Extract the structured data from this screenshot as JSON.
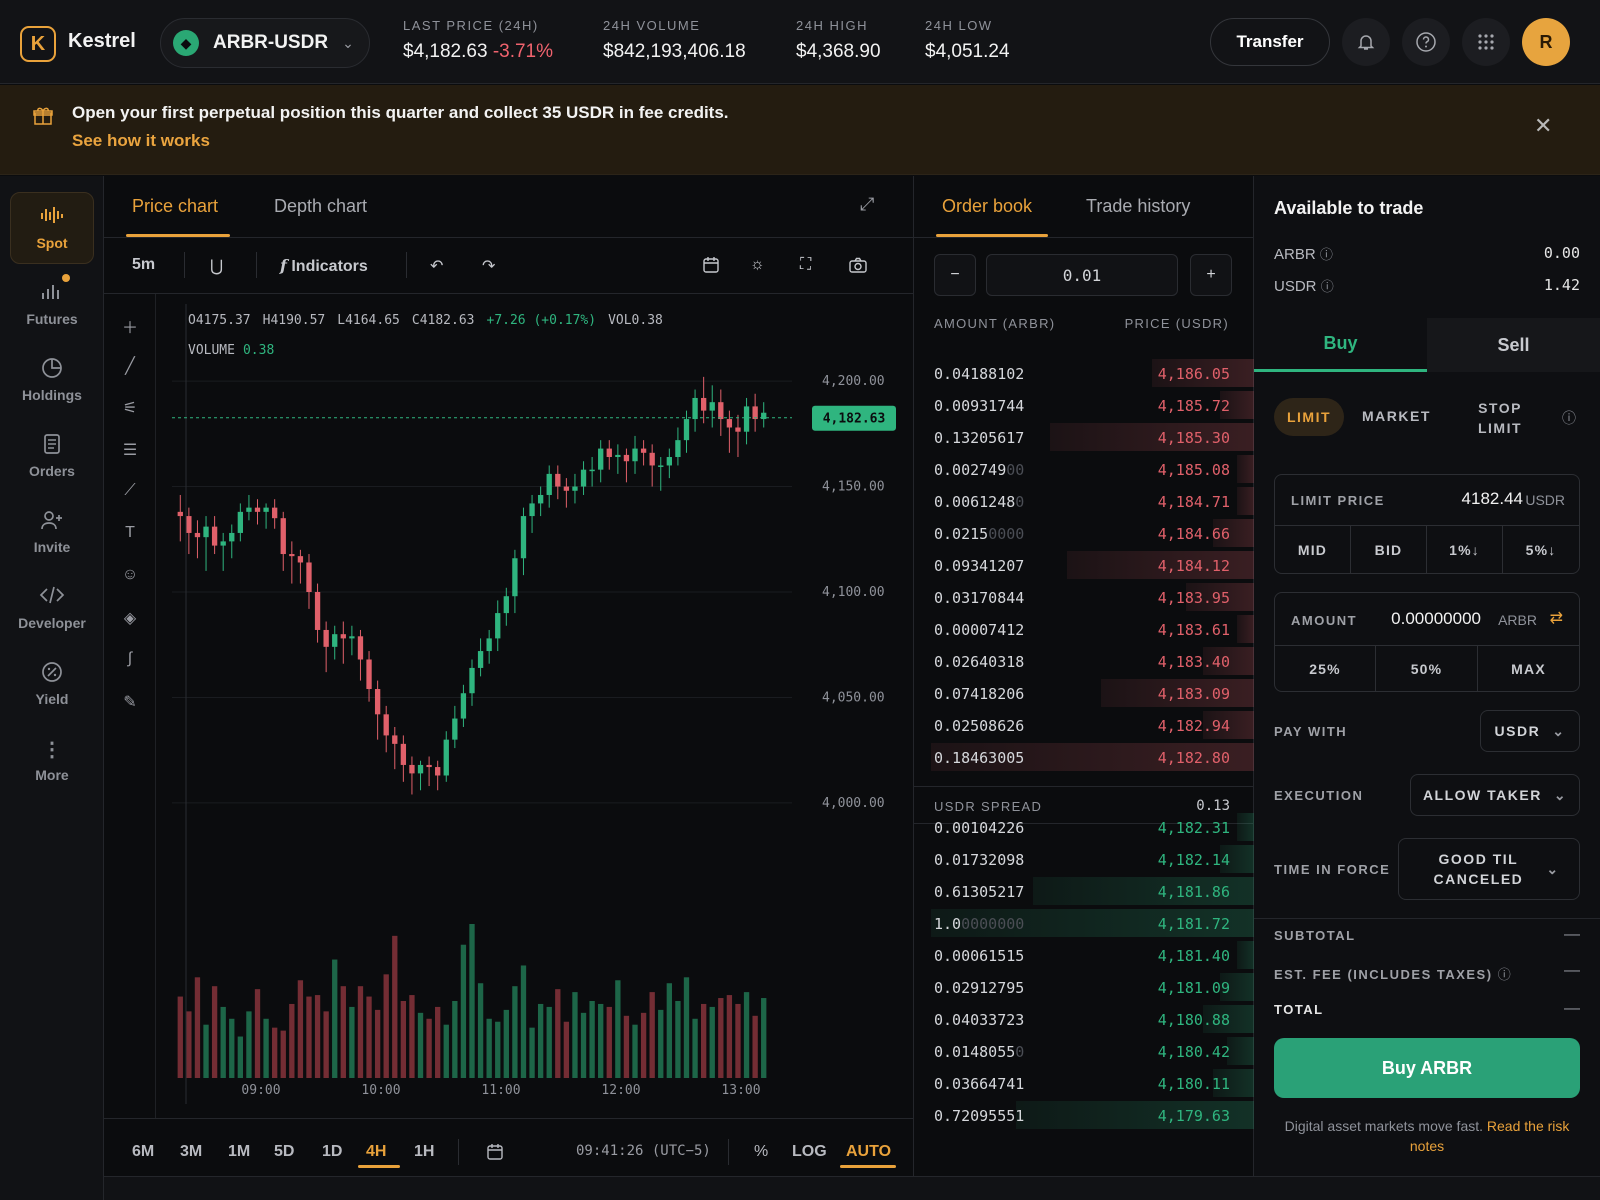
{
  "app": {
    "name": "Kestrel",
    "logo_letter": "K"
  },
  "pair": {
    "name": "ARBR-USDR",
    "icon": "diamond-icon"
  },
  "stats": [
    {
      "label": "LAST PRICE (24H)",
      "value": "$4,182.63",
      "change": "-3.71%"
    },
    {
      "label": "24H VOLUME",
      "value": "$842,193,406.18"
    },
    {
      "label": "24H HIGH",
      "value": "$4,368.90"
    },
    {
      "label": "24H LOW",
      "value": "$4,051.24"
    }
  ],
  "header": {
    "transfer_label": "Transfer",
    "avatar_initial": "R"
  },
  "promo": {
    "text": "Open your first perpetual position this quarter and collect 35 USDR in fee credits.",
    "link": "See how it works"
  },
  "sidebar": {
    "items": [
      {
        "label": "Spot",
        "icon": "spot-icon"
      },
      {
        "label": "Futures",
        "icon": "futures-icon"
      },
      {
        "label": "Holdings",
        "icon": "pie-icon"
      },
      {
        "label": "Orders",
        "icon": "document-icon"
      },
      {
        "label": "Invite",
        "icon": "add-user-icon"
      },
      {
        "label": "Developer",
        "icon": "code-icon"
      },
      {
        "label": "Yield",
        "icon": "percent-icon"
      },
      {
        "label": "More",
        "icon": "more-icon"
      }
    ]
  },
  "chart_panel": {
    "tabs": [
      "Price chart",
      "Depth chart"
    ],
    "interval": "5m",
    "indicators_label": "Indicators",
    "ohlc": {
      "o": "O4175.37",
      "h": "H4190.57",
      "l": "L4164.65",
      "c": "C4182.63",
      "chg": "+7.26 (+0.17%)",
      "vol": "VOL0.38"
    },
    "volume_label": "VOLUME",
    "volume_value": "0.38",
    "ranges": [
      "6M",
      "3M",
      "1M",
      "5D",
      "1D",
      "4H",
      "1H"
    ],
    "active_range": "4H",
    "clock": "09:41:26 (UTC−5)",
    "percent_label": "%",
    "log_label": "LOG",
    "auto_label": "AUTO"
  },
  "chart_data": {
    "type": "candlestick",
    "y_ticks": [
      "4,200.00",
      "4,150.00",
      "4,100.00",
      "4,050.00",
      "4,000.00"
    ],
    "y_tick_values": [
      4200,
      4150,
      4100,
      4050,
      4000
    ],
    "ylim": [
      3990,
      4210
    ],
    "x_ticks": [
      "09:00",
      "10:00",
      "11:00",
      "12:00",
      "13:00"
    ],
    "last_price_label": "4,182.63",
    "last_price": 4182.63,
    "colors": {
      "up": "#2fb57f",
      "down": "#e0606a"
    },
    "candles": [
      [
        4138,
        4136,
        4146,
        4124,
        3
      ],
      [
        4136,
        4128,
        4140,
        4118,
        5
      ],
      [
        4128,
        4126,
        4134,
        4116,
        2
      ],
      [
        4126,
        4131,
        4136,
        4110,
        3
      ],
      [
        4131,
        4122,
        4136,
        4118,
        6
      ],
      [
        4122,
        4124,
        4128,
        4110,
        7
      ],
      [
        4124,
        4128,
        4132,
        4116,
        4
      ],
      [
        4128,
        4138,
        4142,
        4124,
        5
      ],
      [
        4138,
        4140,
        4146,
        4134,
        2
      ],
      [
        4140,
        4138,
        4144,
        4132,
        3
      ],
      [
        4138,
        4140,
        4142,
        4130,
        2
      ],
      [
        4140,
        4135,
        4144,
        4130,
        5
      ],
      [
        4135,
        4118,
        4138,
        4110,
        4
      ],
      [
        4118,
        4117,
        4124,
        4104,
        2
      ],
      [
        4117,
        4114,
        4120,
        4104,
        5
      ],
      [
        4114,
        4100,
        4118,
        4092,
        3
      ],
      [
        4100,
        4082,
        4104,
        4076,
        6
      ],
      [
        4082,
        4074,
        4086,
        4062,
        4
      ],
      [
        4074,
        4080,
        4084,
        4068,
        3
      ],
      [
        4080,
        4078,
        4086,
        4066,
        4
      ],
      [
        4078,
        4079,
        4084,
        4070,
        5
      ],
      [
        4079,
        4068,
        4082,
        4058,
        7
      ],
      [
        4068,
        4054,
        4072,
        4048,
        4
      ],
      [
        4054,
        4042,
        4058,
        4030,
        5
      ],
      [
        4042,
        4032,
        4046,
        4024,
        6
      ],
      [
        4032,
        4028,
        4036,
        4016,
        3
      ],
      [
        4028,
        4018,
        4032,
        4010,
        4
      ],
      [
        4018,
        4014,
        4022,
        4004,
        3
      ],
      [
        4014,
        4018,
        4020,
        4006,
        4
      ],
      [
        4018,
        4017,
        4022,
        4008,
        5
      ],
      [
        4017,
        4013,
        4020,
        4006,
        3
      ],
      [
        4013,
        4030,
        4034,
        4010,
        6
      ],
      [
        4030,
        4040,
        4046,
        4026,
        4
      ],
      [
        4040,
        4052,
        4056,
        4036,
        5
      ],
      [
        4052,
        4064,
        4068,
        4046,
        5
      ],
      [
        4064,
        4072,
        4078,
        4060,
        6
      ],
      [
        4072,
        4078,
        4082,
        4066,
        4
      ],
      [
        4078,
        4090,
        4096,
        4072,
        6
      ],
      [
        4090,
        4098,
        4102,
        4084,
        3
      ],
      [
        4098,
        4116,
        4120,
        4090,
        5
      ],
      [
        4116,
        4136,
        4140,
        4108,
        7
      ],
      [
        4136,
        4142,
        4146,
        4128,
        4
      ],
      [
        4142,
        4146,
        4150,
        4136,
        3
      ],
      [
        4146,
        4156,
        4160,
        4140,
        6
      ],
      [
        4156,
        4150,
        4160,
        4144,
        4
      ],
      [
        4150,
        4148,
        4154,
        4140,
        3
      ],
      [
        4148,
        4150,
        4156,
        4142,
        5
      ],
      [
        4150,
        4158,
        4162,
        4146,
        4
      ],
      [
        4158,
        4158,
        4164,
        4150,
        3
      ],
      [
        4158,
        4168,
        4172,
        4152,
        5
      ],
      [
        4168,
        4164,
        4172,
        4158,
        4
      ],
      [
        4164,
        4165,
        4170,
        4156,
        3
      ],
      [
        4165,
        4162,
        4168,
        4152,
        5
      ],
      [
        4162,
        4168,
        4174,
        4156,
        4
      ],
      [
        4168,
        4166,
        4172,
        4160,
        3
      ],
      [
        4166,
        4160,
        4170,
        4150,
        6
      ],
      [
        4160,
        4160,
        4164,
        4148,
        5
      ],
      [
        4160,
        4164,
        4168,
        4154,
        4
      ],
      [
        4164,
        4172,
        4178,
        4160,
        6
      ],
      [
        4172,
        4182,
        4186,
        4166,
        7
      ],
      [
        4182,
        4192,
        4196,
        4176,
        5
      ],
      [
        4192,
        4186,
        4202,
        4180,
        4
      ],
      [
        4186,
        4190,
        4198,
        4178,
        5
      ],
      [
        4190,
        4182,
        4196,
        4174,
        3
      ],
      [
        4182,
        4178,
        4186,
        4166,
        4
      ],
      [
        4178,
        4176,
        4184,
        4164,
        3
      ],
      [
        4176,
        4188,
        4192,
        4170,
        5
      ],
      [
        4188,
        4182,
        4194,
        4176,
        2
      ],
      [
        4182,
        4185,
        4190,
        4178,
        3
      ]
    ],
    "volumes": [
      55,
      45,
      68,
      36,
      62,
      48,
      40,
      28,
      45,
      60,
      40,
      34,
      32,
      50,
      66,
      55,
      56,
      45,
      80,
      62,
      48,
      62,
      55,
      46,
      70,
      96,
      52,
      56,
      44,
      40,
      48,
      36,
      52,
      90,
      104,
      64,
      40,
      38,
      46,
      62,
      76,
      34,
      50,
      48,
      60,
      38,
      58,
      44,
      52,
      50,
      48,
      66,
      42,
      36,
      44,
      58,
      46,
      64,
      52,
      68,
      40,
      50,
      48,
      54,
      56,
      50,
      58,
      42,
      54
    ]
  },
  "order_book": {
    "tabs": [
      "Order book",
      "Trade history"
    ],
    "step": "0.01",
    "minus": "−",
    "plus": "+",
    "headers": {
      "amount": "AMOUNT (ARBR)",
      "price": "PRICE (USDR)"
    },
    "asks": [
      {
        "amt": "0.04188102",
        "dim": "",
        "price": "4,186.05",
        "depth": 0.3
      },
      {
        "amt": "0.00931744",
        "dim": "",
        "price": "4,185.72",
        "depth": 0.1
      },
      {
        "amt": "0.13205617",
        "dim": "",
        "price": "4,185.30",
        "depth": 0.6
      },
      {
        "amt": "0.002749",
        "dim": "00",
        "price": "4,185.08",
        "depth": 0.05
      },
      {
        "amt": "0.0061248",
        "dim": "0",
        "price": "4,184.71",
        "depth": 0.05
      },
      {
        "amt": "0.0215",
        "dim": "0000",
        "price": "4,184.66",
        "depth": 0.12
      },
      {
        "amt": "0.09341207",
        "dim": "",
        "price": "4,184.12",
        "depth": 0.55
      },
      {
        "amt": "0.03170844",
        "dim": "",
        "price": "4,183.95",
        "depth": 0.2
      },
      {
        "amt": "0.00007412",
        "dim": "",
        "price": "4,183.61",
        "depth": 0.05
      },
      {
        "amt": "0.02640318",
        "dim": "",
        "price": "4,183.40",
        "depth": 0.15
      },
      {
        "amt": "0.07418206",
        "dim": "",
        "price": "4,183.09",
        "depth": 0.45
      },
      {
        "amt": "0.02508626",
        "dim": "",
        "price": "4,182.94",
        "depth": 0.15
      },
      {
        "amt": "0.18463005",
        "dim": "",
        "price": "4,182.80",
        "depth": 0.95
      }
    ],
    "spread_label": "USDR SPREAD",
    "spread_value": "0.13",
    "bids": [
      {
        "amt": "0.00104226",
        "dim": "",
        "price": "4,182.31",
        "depth": 0.05
      },
      {
        "amt": "0.01732098",
        "dim": "",
        "price": "4,182.14",
        "depth": 0.1
      },
      {
        "amt": "0.61305217",
        "dim": "",
        "price": "4,181.86",
        "depth": 0.65
      },
      {
        "amt": "1.0",
        "dim": "0000000",
        "price": "4,181.72",
        "depth": 0.95
      },
      {
        "amt": "0.00061515",
        "dim": "",
        "price": "4,181.40",
        "depth": 0.05
      },
      {
        "amt": "0.02912795",
        "dim": "",
        "price": "4,181.09",
        "depth": 0.1
      },
      {
        "amt": "0.04033723",
        "dim": "",
        "price": "4,180.88",
        "depth": 0.15
      },
      {
        "amt": "0.0148055",
        "dim": "0",
        "price": "4,180.42",
        "depth": 0.08
      },
      {
        "amt": "0.03664741",
        "dim": "",
        "price": "4,180.11",
        "depth": 0.12
      },
      {
        "amt": "0.72095551",
        "dim": "",
        "price": "4,179.63",
        "depth": 0.7
      }
    ]
  },
  "trade": {
    "available_title": "Available to trade",
    "balances": [
      {
        "asset": "ARBR",
        "value": "0.00"
      },
      {
        "asset": "USDR",
        "value": "1.42"
      }
    ],
    "side_tabs": [
      "Buy",
      "Sell"
    ],
    "order_types": [
      "LIMIT",
      "MARKET",
      "STOP LIMIT"
    ],
    "limit_price_label": "LIMIT PRICE",
    "limit_price_value": "4182.44",
    "limit_price_unit": "USDR",
    "price_presets": [
      "MID",
      "BID",
      "1%↓",
      "5%↓"
    ],
    "amount_label": "AMOUNT",
    "amount_value": "0.00000000",
    "amount_unit": "ARBR",
    "amount_presets": [
      "25%",
      "50%",
      "MAX"
    ],
    "pay_with_label": "PAY WITH",
    "pay_with_value": "USDR",
    "execution_label": "EXECUTION",
    "execution_value": "ALLOW TAKER",
    "tif_label": "TIME IN FORCE",
    "tif_value": "GOOD TIL CANCELED",
    "subtotal_label": "SUBTOTAL",
    "fee_label": "EST. FEE (INCLUDES TAXES)",
    "total_label": "TOTAL",
    "dash": "—",
    "buy_button": "Buy ARBR",
    "footnote": "Digital asset markets move fast.",
    "footnote_link": "Read the risk notes"
  }
}
